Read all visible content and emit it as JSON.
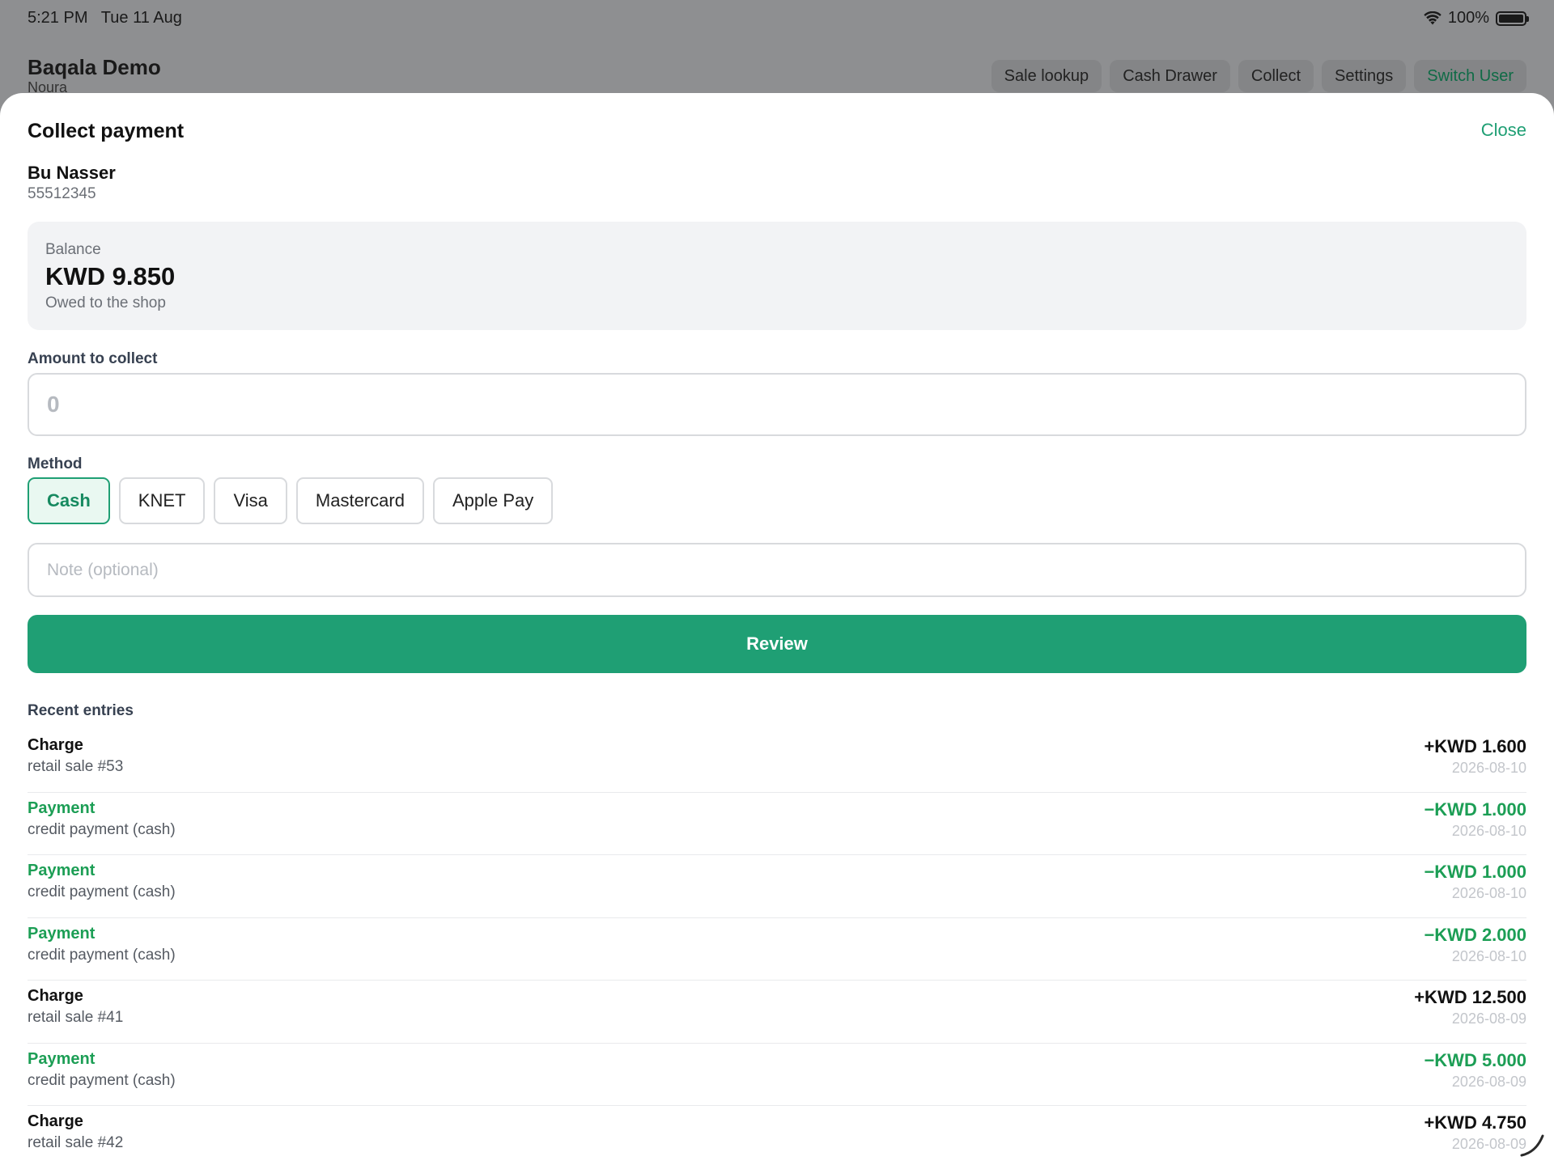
{
  "status": {
    "time": "5:21 PM",
    "date": "Tue 11 Aug",
    "battery": "100%"
  },
  "app": {
    "title": "Baqala Demo",
    "user": "Noura",
    "nav": [
      "Sale lookup",
      "Cash Drawer",
      "Collect",
      "Settings",
      "Switch User"
    ]
  },
  "sheet": {
    "title": "Collect payment",
    "close_label": "Close",
    "customer": {
      "name": "Bu Nasser",
      "phone": "55512345"
    },
    "balance": {
      "label": "Balance",
      "value": "KWD 9.850",
      "sub": "Owed to the shop"
    },
    "amount": {
      "label": "Amount to collect",
      "placeholder": "0",
      "value": ""
    },
    "method": {
      "label": "Method",
      "options": [
        "Cash",
        "KNET",
        "Visa",
        "Mastercard",
        "Apple Pay"
      ],
      "selected": "Cash"
    },
    "note": {
      "placeholder": "Note (optional)",
      "value": ""
    },
    "review_label": "Review",
    "recent_title": "Recent entries",
    "entries": [
      {
        "type": "Charge",
        "desc": "retail sale #53",
        "amount": "+KWD 1.600",
        "date": "2026-08-10"
      },
      {
        "type": "Payment",
        "desc": "credit payment (cash)",
        "amount": "−KWD 1.000",
        "date": "2026-08-10"
      },
      {
        "type": "Payment",
        "desc": "credit payment (cash)",
        "amount": "−KWD 1.000",
        "date": "2026-08-10"
      },
      {
        "type": "Payment",
        "desc": "credit payment (cash)",
        "amount": "−KWD 2.000",
        "date": "2026-08-10"
      },
      {
        "type": "Charge",
        "desc": "retail sale #41",
        "amount": "+KWD 12.500",
        "date": "2026-08-09"
      },
      {
        "type": "Payment",
        "desc": "credit payment (cash)",
        "amount": "−KWD 5.000",
        "date": "2026-08-09"
      },
      {
        "type": "Charge",
        "desc": "retail sale #42",
        "amount": "+KWD 4.750",
        "date": "2026-08-09"
      }
    ]
  },
  "colors": {
    "accent": "#1f9f74",
    "payment": "#1c9e55",
    "backdrop": "#8e8f91"
  }
}
